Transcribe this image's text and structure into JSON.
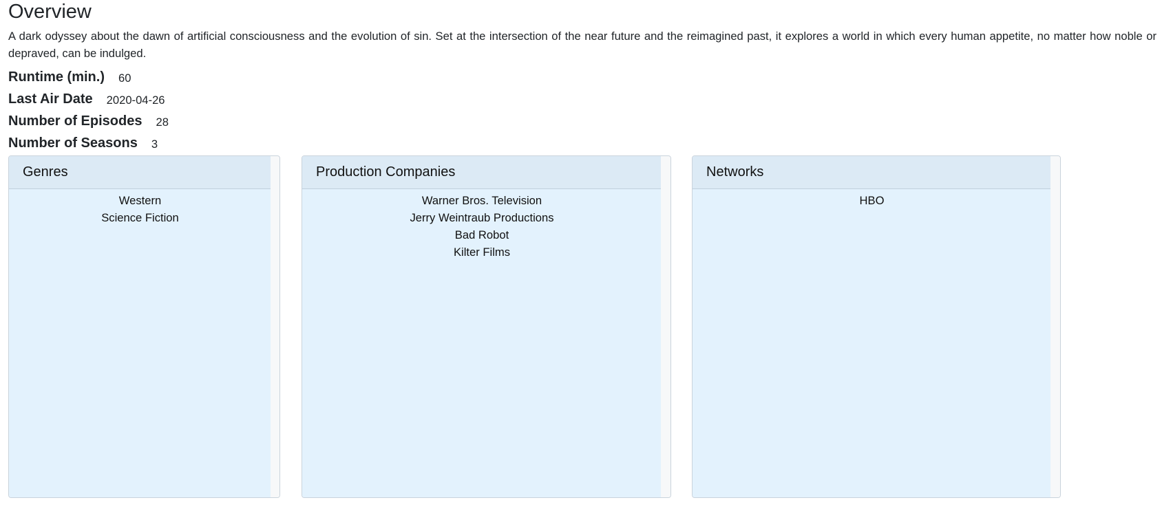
{
  "overview": {
    "title": "Overview",
    "text": "A dark odyssey about the dawn of artificial consciousness and the evolution of sin. Set at the intersection of the near future and the reimagined past, it explores a world in which every human appetite, no matter how noble or depraved, can be indulged."
  },
  "facts": [
    {
      "label": "Runtime (min.)",
      "value": "60"
    },
    {
      "label": "Last Air Date",
      "value": "2020-04-26"
    },
    {
      "label": "Number of Episodes",
      "value": "28"
    },
    {
      "label": "Number of Seasons",
      "value": "3"
    }
  ],
  "cards": {
    "genres": {
      "title": "Genres",
      "items": [
        "Western",
        "Science Fiction"
      ]
    },
    "production": {
      "title": "Production Companies",
      "items": [
        "Warner Bros. Television",
        "Jerry Weintraub Productions",
        "Bad Robot",
        "Kilter Films"
      ]
    },
    "networks": {
      "title": "Networks",
      "items": [
        "HBO"
      ]
    }
  }
}
